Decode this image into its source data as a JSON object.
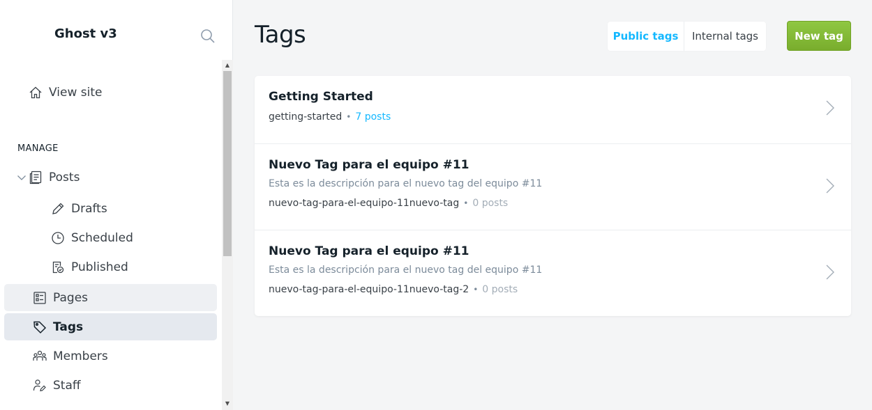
{
  "sidebar": {
    "brand": "Ghost v3",
    "view_site": "View site",
    "manage_title": "MANAGE",
    "posts": "Posts",
    "drafts": "Drafts",
    "scheduled": "Scheduled",
    "published": "Published",
    "pages": "Pages",
    "tags": "Tags",
    "members": "Members",
    "staff": "Staff",
    "icons": {
      "search": "search-icon",
      "view_site": "home-icon",
      "posts": "posts-icon",
      "drafts": "pencil-icon",
      "scheduled": "clock-icon",
      "published": "published-icon",
      "pages": "pages-icon",
      "tags": "tag-icon",
      "members": "members-icon",
      "staff": "staff-icon"
    }
  },
  "main": {
    "title": "Tags",
    "toggle": {
      "public": "Public tags",
      "internal": "Internal tags",
      "selected": "Public tags"
    },
    "new_tag": "New tag",
    "tags": [
      {
        "name": "Getting Started",
        "description": "",
        "slug": "getting-started",
        "count": "7 posts"
      },
      {
        "name": "Nuevo Tag para el equipo #11",
        "description": "Esta es la descripción para el nuevo tag del equipo #11",
        "slug": "nuevo-tag-para-el-equipo-11nuevo-tag",
        "count": "0 posts"
      },
      {
        "name": "Nuevo Tag para el equipo #11",
        "description": "Esta es la descripción para el nuevo tag del equipo #11",
        "slug": "nuevo-tag-para-el-equipo-11nuevo-tag-2",
        "count": "0 posts"
      }
    ]
  },
  "colors": {
    "accent_blue": "#14b8ff",
    "green_button": "#8fc742",
    "active_nav": "#e5e9ef"
  }
}
